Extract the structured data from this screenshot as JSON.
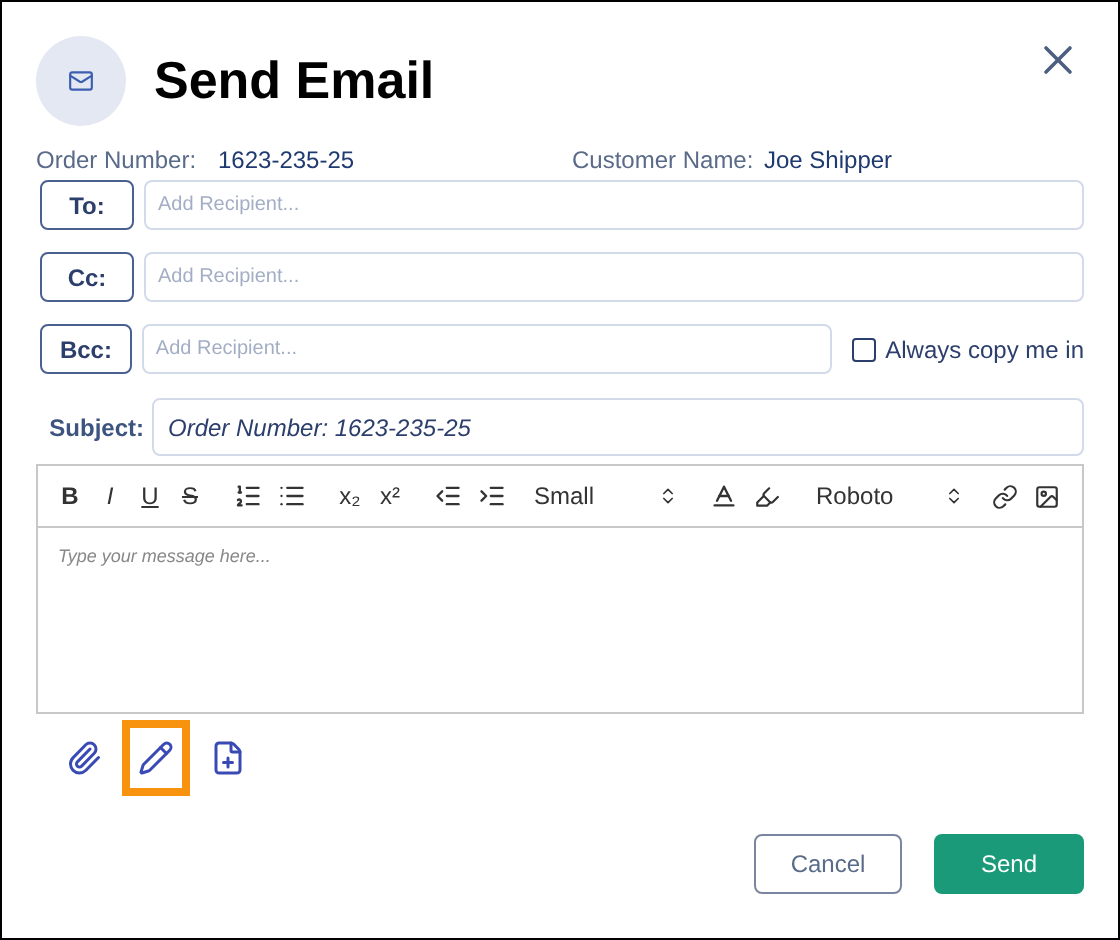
{
  "dialog": {
    "title": "Send Email"
  },
  "order": {
    "label": "Order Number:",
    "value": "1623-235-25"
  },
  "customer": {
    "label": "Customer Name:",
    "value": "Joe Shipper"
  },
  "recipients": [
    {
      "label": "To:",
      "placeholder": "Add Recipient..."
    },
    {
      "label": "Cc:",
      "placeholder": "Add Recipient..."
    },
    {
      "label": "Bcc:",
      "placeholder": "Add Recipient..."
    }
  ],
  "always_copy": {
    "label": "Always copy me in",
    "checked": false
  },
  "subject": {
    "label": "Subject:",
    "value": "Order Number: 1623-235-25"
  },
  "toolbar": {
    "bold": "B",
    "italic": "I",
    "underline": "U",
    "strike": "S",
    "subscript": "x₂",
    "superscript": "x²",
    "size": "Small",
    "font": "Roboto"
  },
  "message": {
    "placeholder": "Type your message here..."
  },
  "tools": [
    {
      "selected": false
    },
    {
      "selected": true
    },
    {
      "selected": false
    }
  ],
  "buttons": {
    "cancel": "Cancel",
    "send": "Send"
  }
}
